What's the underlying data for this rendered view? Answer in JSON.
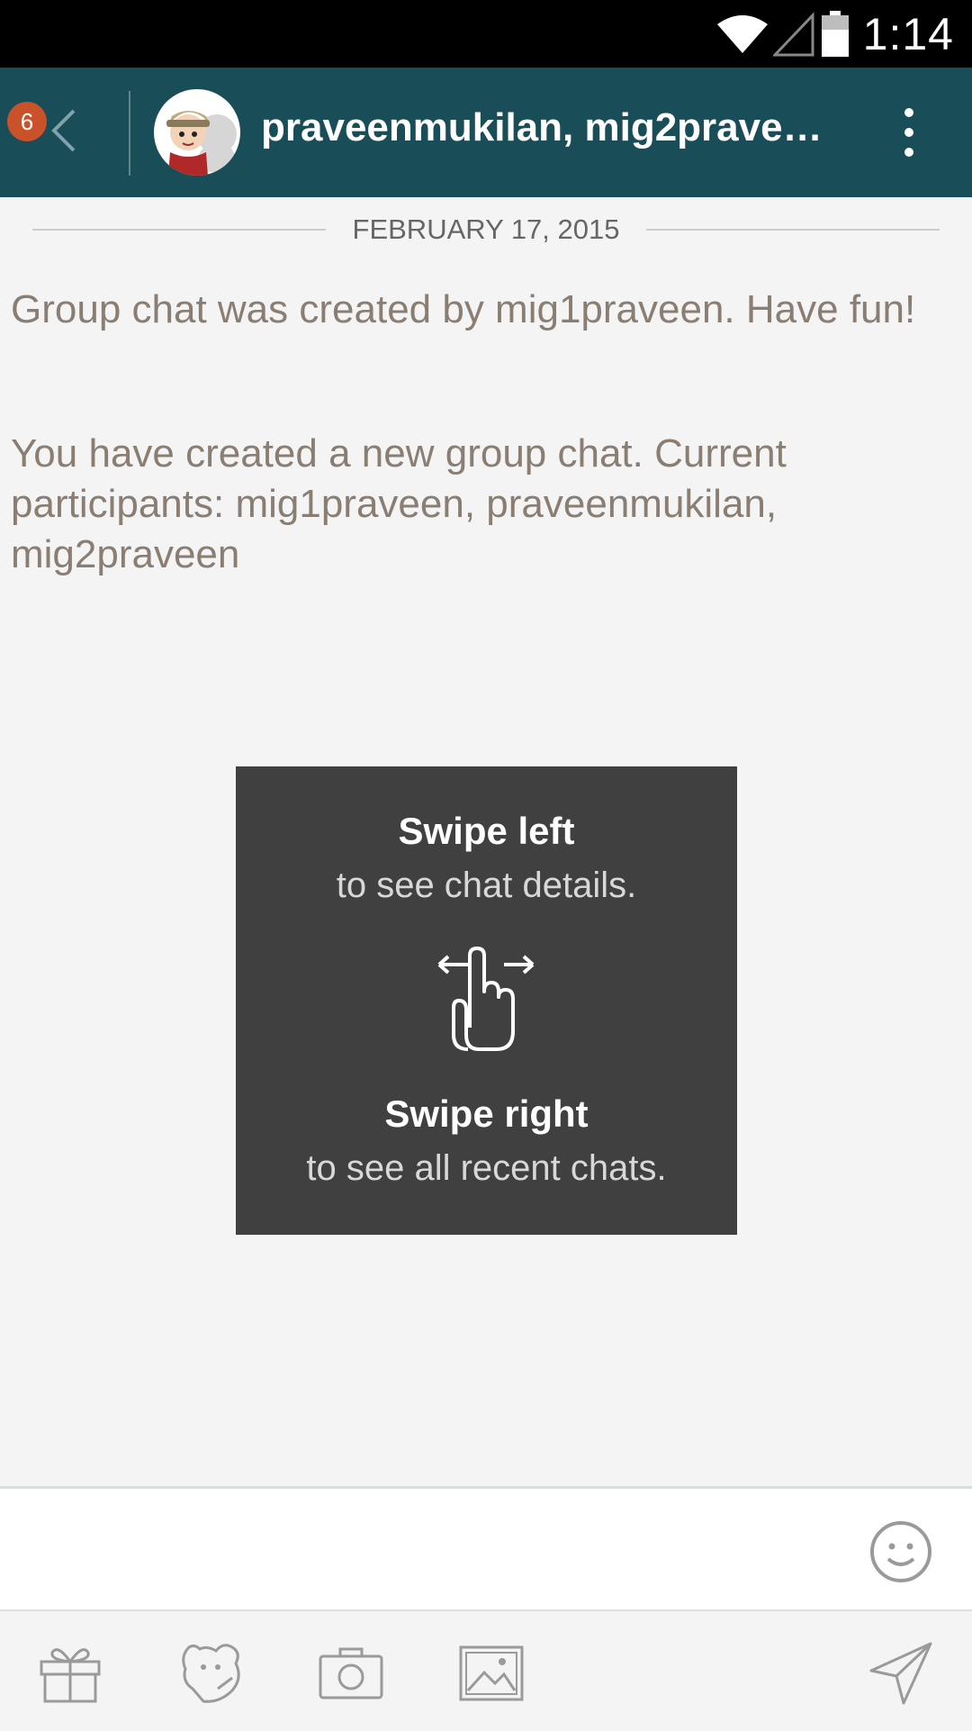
{
  "status_bar": {
    "time": "1:14",
    "icons": [
      "wifi-icon",
      "signal-icon",
      "battery-icon"
    ]
  },
  "header": {
    "unread_badge": "6",
    "title": "praveenmukilan, mig2praveen …",
    "bg_color": "#194d57"
  },
  "chat": {
    "date": "FEBRUARY 17, 2015",
    "messages": [
      "Group chat was created by mig1praveen. Have fun!",
      "You have created a new group chat. Current participants: mig1praveen, praveenmukilan, mig2praveen"
    ]
  },
  "tutorial": {
    "swipe_left_title": "Swipe left",
    "swipe_left_desc": "to see chat details.",
    "swipe_right_title": "Swipe right",
    "swipe_right_desc": "to see all recent chats."
  },
  "toolbar": {
    "icons": [
      "gift-icon",
      "sticker-icon",
      "camera-icon",
      "image-icon",
      "send-icon"
    ]
  }
}
